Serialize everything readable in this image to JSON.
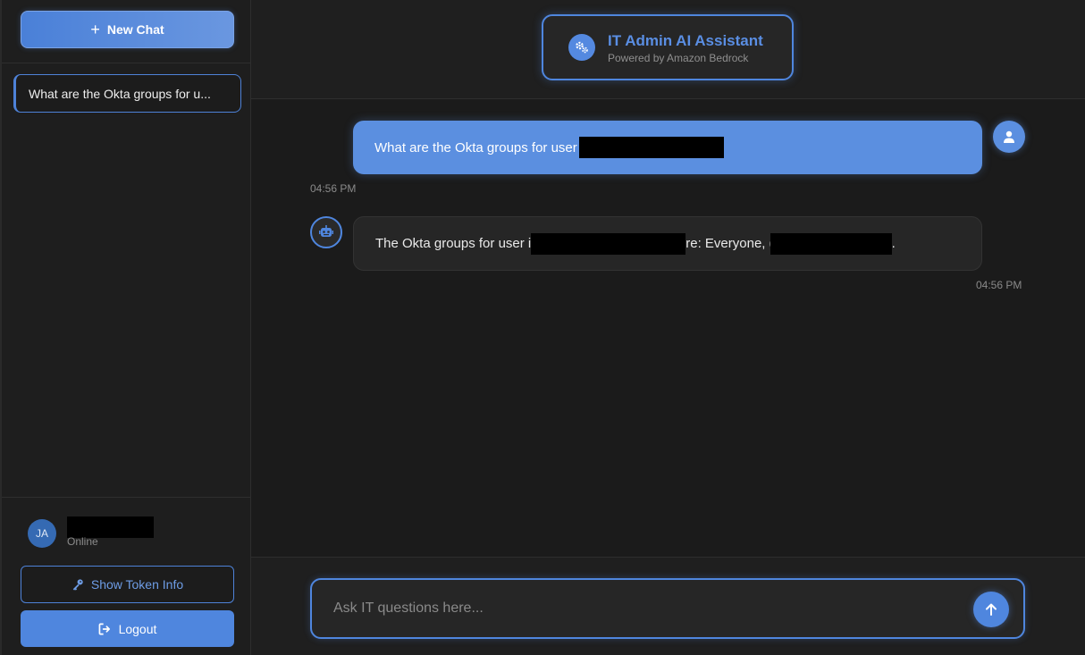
{
  "sidebar": {
    "new_chat_label": "New Chat",
    "chats": [
      {
        "label": "What are the Okta groups for u..."
      }
    ],
    "user": {
      "initials": "JA",
      "status": "Online"
    },
    "token_button_label": "Show Token Info",
    "logout_label": "Logout"
  },
  "header": {
    "title": "IT Admin AI Assistant",
    "subtitle": "Powered by Amazon Bedrock"
  },
  "messages": [
    {
      "role": "user",
      "text": "What are the Okta groups for user",
      "time": "04:56 PM"
    },
    {
      "role": "assistant",
      "text_before": "The Okta groups for user i",
      "text_middle": "re: Everyone, (",
      "text_after": ".",
      "time": "04:56 PM"
    }
  ],
  "input": {
    "placeholder": "Ask IT questions here..."
  },
  "colors": {
    "accent": "#4f86de",
    "background": "#1b1b1b",
    "user_bubble": "#5b8fe0",
    "bot_bubble": "#262626"
  }
}
